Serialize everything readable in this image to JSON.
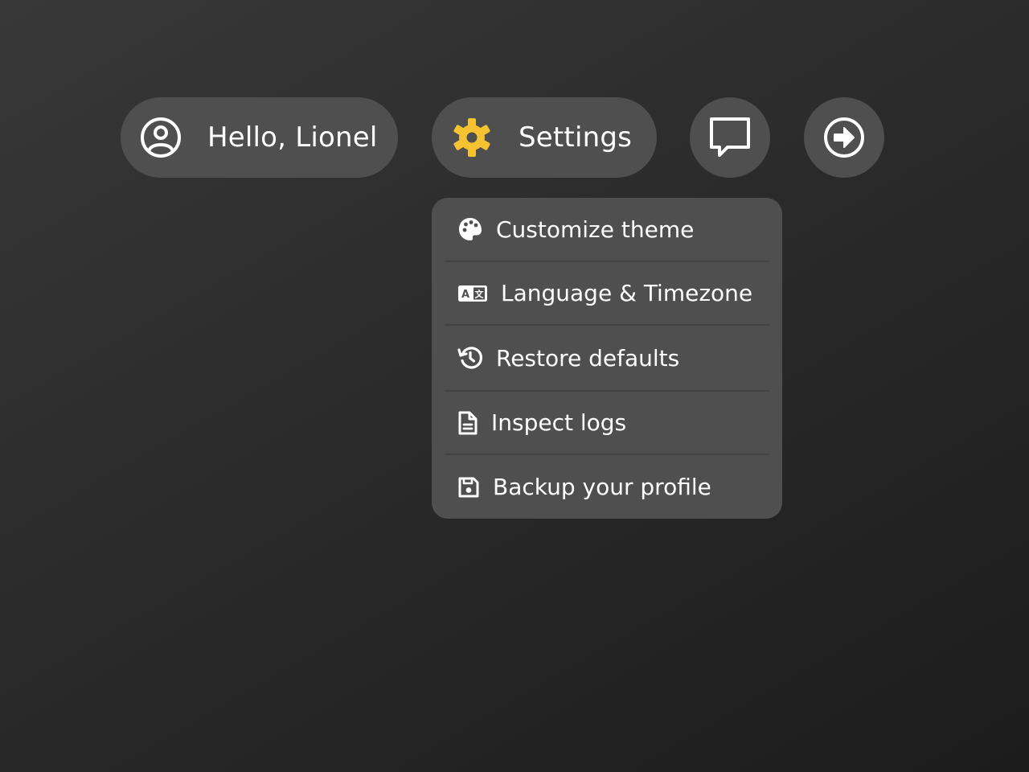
{
  "user": {
    "greeting": "Hello, Lionel"
  },
  "settings": {
    "label": "Settings"
  },
  "menu": {
    "items": [
      {
        "label": "Customize theme",
        "icon": "palette-icon"
      },
      {
        "label": "Language & Timezone",
        "icon": "language-icon"
      },
      {
        "label": "Restore defaults",
        "icon": "history-icon"
      },
      {
        "label": "Inspect logs",
        "icon": "file-icon"
      },
      {
        "label": "Backup your profile",
        "icon": "save-icon"
      }
    ]
  },
  "icons": {
    "user": "user-circle-icon",
    "settings": "gear-icon",
    "chat": "chat-icon",
    "logout": "arrow-right-circle-icon"
  },
  "colors": {
    "accent": "#f5c331",
    "pill": "#4f4f4f",
    "text": "#ffffff"
  }
}
